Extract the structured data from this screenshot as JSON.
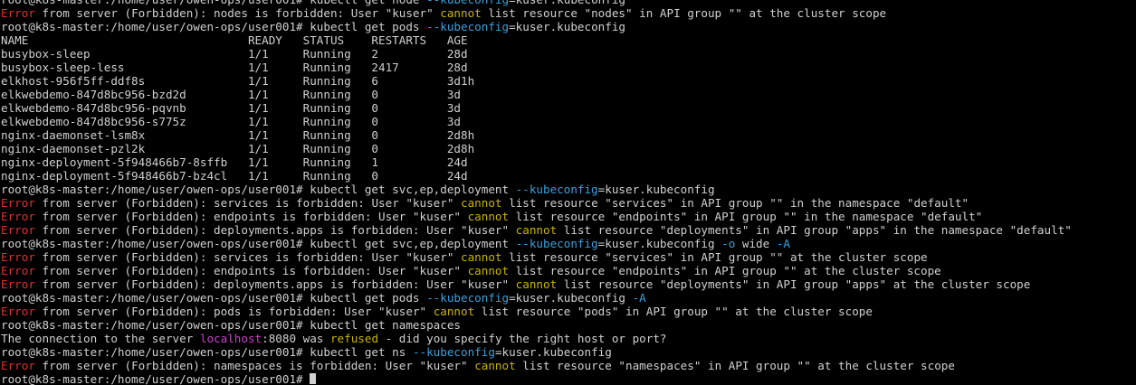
{
  "terminal": {
    "colors": {
      "background": "#000000",
      "foreground": "#d0d0d0",
      "error": "#e03030",
      "keyword": "#c8b400",
      "option": "#3aa0dc",
      "host": "#d03cd0"
    },
    "lines": [
      {
        "segments": [
          {
            "text": "root@k8s-master:/home/user/owen-ops/user001# kubectl get node ",
            "color": "default"
          },
          {
            "text": "--kubeconfig",
            "color": "cyan"
          },
          {
            "text": "=kuser.kubeconfig",
            "color": "default"
          }
        ]
      },
      {
        "segments": [
          {
            "text": "Error",
            "color": "red"
          },
          {
            "text": " from server (Forbidden): nodes is forbidden: User \"kuser\" ",
            "color": "default"
          },
          {
            "text": "cannot",
            "color": "yellow"
          },
          {
            "text": " list resource \"nodes\" in API group \"\" at the cluster scope",
            "color": "default"
          }
        ]
      },
      {
        "segments": [
          {
            "text": "root@k8s-master:/home/user/owen-ops/user001# kubectl get pods ",
            "color": "default"
          },
          {
            "text": "--kubeconfig",
            "color": "cyan"
          },
          {
            "text": "=kuser.kubeconfig",
            "color": "default"
          }
        ]
      },
      {
        "segments": [
          {
            "text": "NAME                                READY   STATUS    RESTARTS   AGE",
            "color": "default"
          }
        ]
      },
      {
        "segments": [
          {
            "text": "busybox-sleep                       1/1     Running   2          28d",
            "color": "default"
          }
        ]
      },
      {
        "segments": [
          {
            "text": "busybox-sleep-less                  1/1     Running   2417       28d",
            "color": "default"
          }
        ]
      },
      {
        "segments": [
          {
            "text": "elkhost-956f5ff-ddf8s               1/1     Running   6          3d1h",
            "color": "default"
          }
        ]
      },
      {
        "segments": [
          {
            "text": "elkwebdemo-847d8bc956-bzd2d         1/1     Running   0          3d",
            "color": "default"
          }
        ]
      },
      {
        "segments": [
          {
            "text": "elkwebdemo-847d8bc956-pqvnb         1/1     Running   0          3d",
            "color": "default"
          }
        ]
      },
      {
        "segments": [
          {
            "text": "elkwebdemo-847d8bc956-s775z         1/1     Running   0          3d",
            "color": "default"
          }
        ]
      },
      {
        "segments": [
          {
            "text": "nginx-daemonset-lsm8x               1/1     Running   0          2d8h",
            "color": "default"
          }
        ]
      },
      {
        "segments": [
          {
            "text": "nginx-daemonset-pzl2k               1/1     Running   0          2d8h",
            "color": "default"
          }
        ]
      },
      {
        "segments": [
          {
            "text": "nginx-deployment-5f948466b7-8sffb   1/1     Running   1          24d",
            "color": "default"
          }
        ]
      },
      {
        "segments": [
          {
            "text": "nginx-deployment-5f948466b7-bz4cl   1/1     Running   0          24d",
            "color": "default"
          }
        ]
      },
      {
        "segments": [
          {
            "text": "root@k8s-master:/home/user/owen-ops/user001# kubectl get svc,ep,deployment ",
            "color": "default"
          },
          {
            "text": "--kubeconfig",
            "color": "cyan"
          },
          {
            "text": "=kuser.kubeconfig",
            "color": "default"
          }
        ]
      },
      {
        "segments": [
          {
            "text": "Error",
            "color": "red"
          },
          {
            "text": " from server (Forbidden): services is forbidden: User \"kuser\" ",
            "color": "default"
          },
          {
            "text": "cannot",
            "color": "yellow"
          },
          {
            "text": " list resource \"services\" in API group \"\" in the namespace \"default\"",
            "color": "default"
          }
        ]
      },
      {
        "segments": [
          {
            "text": "Error",
            "color": "red"
          },
          {
            "text": " from server (Forbidden): endpoints is forbidden: User \"kuser\" ",
            "color": "default"
          },
          {
            "text": "cannot",
            "color": "yellow"
          },
          {
            "text": " list resource \"endpoints\" in API group \"\" in the namespace \"default\"",
            "color": "default"
          }
        ]
      },
      {
        "segments": [
          {
            "text": "Error",
            "color": "red"
          },
          {
            "text": " from server (Forbidden): deployments.apps is forbidden: User \"kuser\" ",
            "color": "default"
          },
          {
            "text": "cannot",
            "color": "yellow"
          },
          {
            "text": " list resource \"deployments\" in API group \"apps\" in the namespace \"default\"",
            "color": "default"
          }
        ]
      },
      {
        "segments": [
          {
            "text": "root@k8s-master:/home/user/owen-ops/user001# kubectl get svc,ep,deployment ",
            "color": "default"
          },
          {
            "text": "--kubeconfig",
            "color": "cyan"
          },
          {
            "text": "=kuser.kubeconfig ",
            "color": "default"
          },
          {
            "text": "-o",
            "color": "cyan"
          },
          {
            "text": " wide ",
            "color": "default"
          },
          {
            "text": "-A",
            "color": "cyan"
          }
        ]
      },
      {
        "segments": [
          {
            "text": "Error",
            "color": "red"
          },
          {
            "text": " from server (Forbidden): services is forbidden: User \"kuser\" ",
            "color": "default"
          },
          {
            "text": "cannot",
            "color": "yellow"
          },
          {
            "text": " list resource \"services\" in API group \"\" at the cluster scope",
            "color": "default"
          }
        ]
      },
      {
        "segments": [
          {
            "text": "Error",
            "color": "red"
          },
          {
            "text": " from server (Forbidden): endpoints is forbidden: User \"kuser\" ",
            "color": "default"
          },
          {
            "text": "cannot",
            "color": "yellow"
          },
          {
            "text": " list resource \"endpoints\" in API group \"\" at the cluster scope",
            "color": "default"
          }
        ]
      },
      {
        "segments": [
          {
            "text": "Error",
            "color": "red"
          },
          {
            "text": " from server (Forbidden): deployments.apps is forbidden: User \"kuser\" ",
            "color": "default"
          },
          {
            "text": "cannot",
            "color": "yellow"
          },
          {
            "text": " list resource \"deployments\" in API group \"apps\" at the cluster scope",
            "color": "default"
          }
        ]
      },
      {
        "segments": [
          {
            "text": "root@k8s-master:/home/user/owen-ops/user001# kubectl get pods ",
            "color": "default"
          },
          {
            "text": "--kubeconfig",
            "color": "cyan"
          },
          {
            "text": "=kuser.kubeconfig ",
            "color": "default"
          },
          {
            "text": "-A",
            "color": "cyan"
          }
        ]
      },
      {
        "segments": [
          {
            "text": "Error",
            "color": "red"
          },
          {
            "text": " from server (Forbidden): pods is forbidden: User \"kuser\" ",
            "color": "default"
          },
          {
            "text": "cannot",
            "color": "yellow"
          },
          {
            "text": " list resource \"pods\" in API group \"\" at the cluster scope",
            "color": "default"
          }
        ]
      },
      {
        "segments": [
          {
            "text": "root@k8s-master:/home/user/owen-ops/user001# kubectl get namespaces",
            "color": "default"
          }
        ]
      },
      {
        "segments": [
          {
            "text": "The connection to the server ",
            "color": "default"
          },
          {
            "text": "localhost",
            "color": "magenta"
          },
          {
            "text": ":8080 was ",
            "color": "default"
          },
          {
            "text": "refused",
            "color": "yellow"
          },
          {
            "text": " - did you specify the right host or port?",
            "color": "default"
          }
        ]
      },
      {
        "segments": [
          {
            "text": "root@k8s-master:/home/user/owen-ops/user001# kubectl get ns ",
            "color": "default"
          },
          {
            "text": "--kubeconfig",
            "color": "cyan"
          },
          {
            "text": "=kuser.kubeconfig",
            "color": "default"
          }
        ]
      },
      {
        "segments": [
          {
            "text": "Error",
            "color": "red"
          },
          {
            "text": " from server (Forbidden): namespaces is forbidden: User \"kuser\" ",
            "color": "default"
          },
          {
            "text": "cannot",
            "color": "yellow"
          },
          {
            "text": " list resource \"namespaces\" in API group \"\" at the cluster scope",
            "color": "default"
          }
        ]
      },
      {
        "segments": [
          {
            "text": "root@k8s-master:/home/user/owen-ops/user001# ",
            "color": "default"
          }
        ],
        "cursor": true
      }
    ]
  }
}
